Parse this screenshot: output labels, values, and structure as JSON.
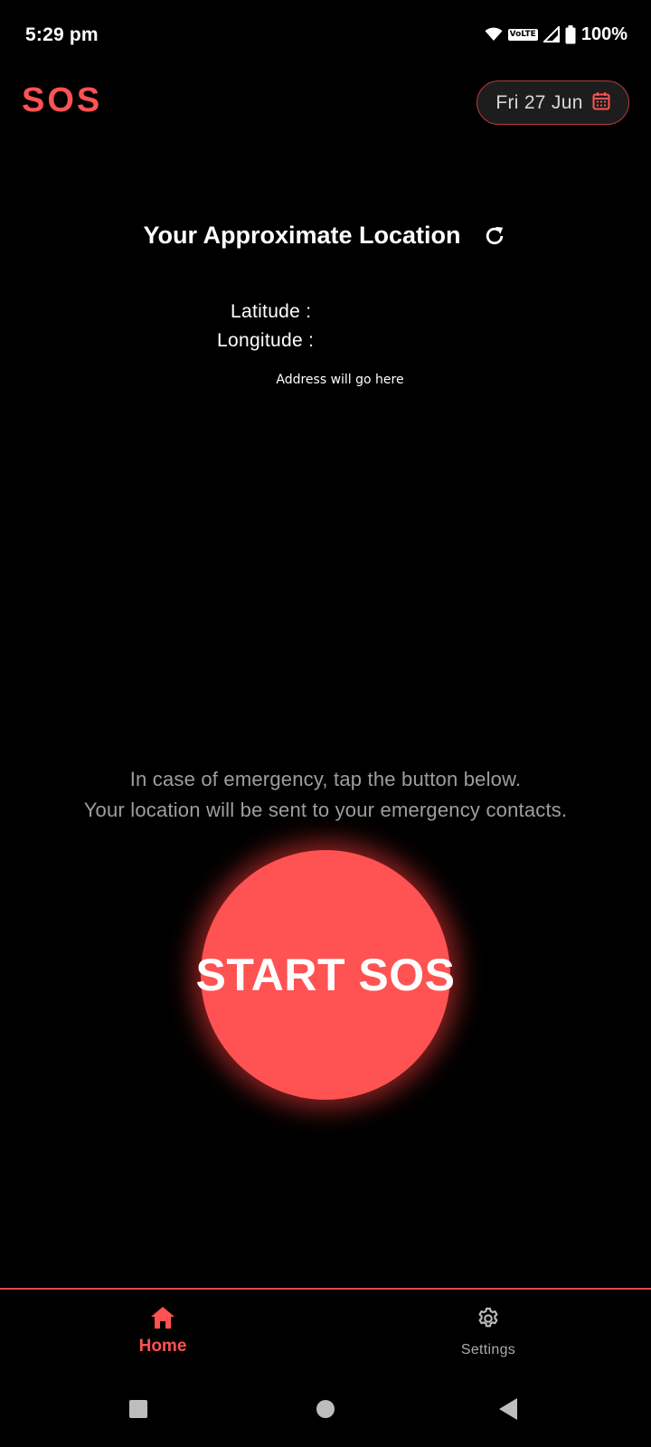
{
  "status_bar": {
    "time": "5:29 pm",
    "network_badge": "VoLTE",
    "battery": "100%",
    "icons": [
      "wifi-icon",
      "signal-icon",
      "battery-icon"
    ]
  },
  "header": {
    "title": "SOS",
    "date": "Fri 27 Jun",
    "date_icon": "calendar-icon"
  },
  "location": {
    "title": "Your Approximate Location",
    "refresh_icon": "refresh-icon",
    "latitude_label": "Latitude :",
    "longitude_label": "Longitude :",
    "address": "Address will go here"
  },
  "instructions": {
    "line1": "In case of emergency, tap the button below.",
    "line2": "Your location will be sent to your emergency contacts."
  },
  "sos_button": {
    "label": "START SOS"
  },
  "bottom_nav": {
    "items": [
      {
        "label": "Home",
        "icon": "home-icon",
        "active": true
      },
      {
        "label": "Settings",
        "icon": "gear-icon",
        "active": false
      }
    ]
  },
  "system_nav": {
    "buttons": [
      "recents-icon",
      "home-circle-icon",
      "back-icon"
    ]
  },
  "colors": {
    "accent": "#ff5252",
    "background": "#000000",
    "muted_text": "#9e9e9e"
  }
}
